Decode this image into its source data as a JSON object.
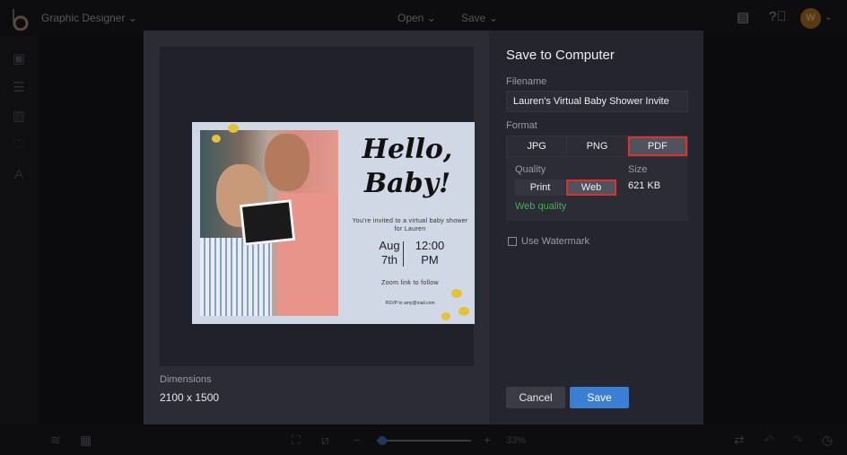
{
  "app": {
    "title": "Graphic Designer",
    "menus": [
      "Open",
      "Save"
    ],
    "avatar_initial": "W"
  },
  "sidebar": {
    "icons": [
      "templates-icon",
      "filters-icon",
      "library-icon",
      "favorites-icon",
      "text-icon"
    ]
  },
  "bottom_bar": {
    "zoom_percent": "33%",
    "zoom_slider_value": 0.05
  },
  "dialog": {
    "title": "Save to Computer",
    "filename_label": "Filename",
    "filename_value": "Lauren's Virtual Baby Shower Invite",
    "format_label": "Format",
    "formats": [
      "JPG",
      "PNG",
      "PDF"
    ],
    "selected_format": "PDF",
    "quality_label": "Quality",
    "qualities": [
      "Print",
      "Web"
    ],
    "selected_quality": "Web",
    "size_label": "Size",
    "size_value": "621 KB",
    "quality_note": "Web quality",
    "watermark_label": "Use Watermark",
    "watermark_checked": false,
    "dimensions_label": "Dimensions",
    "dimensions_value": "2100 x 1500",
    "cancel_label": "Cancel",
    "save_label": "Save"
  },
  "preview_card": {
    "headline": "Hello, Baby!",
    "invite_text": "You're invited to a virtual baby shower for Lauren",
    "date": "Aug 7th",
    "time": "12:00 PM",
    "zoom_text": "Zoom link to follow",
    "rsvp": "RSVP to amy@mail.com"
  }
}
